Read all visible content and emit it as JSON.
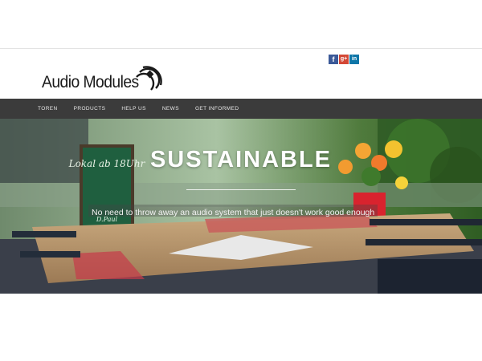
{
  "social": [
    {
      "name": "facebook",
      "glyph": "f",
      "color": "#3b5998"
    },
    {
      "name": "google-plus",
      "glyph": "g+",
      "color": "#d34836"
    },
    {
      "name": "linkedin",
      "glyph": "in",
      "color": "#0e76a8"
    }
  ],
  "logo": {
    "text": "Audio Modules",
    "icon": "sound-waves-icon"
  },
  "nav": {
    "items": [
      "TOREN",
      "PRODUCTS",
      "HELP US",
      "NEWS",
      "GET INFORMED"
    ]
  },
  "hero": {
    "title": "SUSTAINABLE",
    "caption": "No need to throw away an audio system that just doesn't work good enough",
    "chalkboard": {
      "text": "Lokal ab 18Uhr",
      "sign": "D.Paul"
    }
  },
  "colors": {
    "nav_bg": "#3b3b3b",
    "nav_text": "#e6e6e6"
  }
}
